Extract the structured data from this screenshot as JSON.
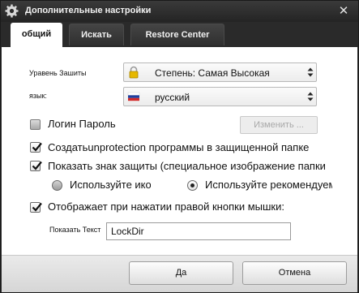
{
  "window": {
    "title": "Дополнительные настройки",
    "close_glyph": "✕"
  },
  "tabs": [
    {
      "label": "общий",
      "active": true
    },
    {
      "label": "Искать",
      "active": false
    },
    {
      "label": "Restore Center",
      "active": false
    }
  ],
  "protection": {
    "label": "Уравень Зашиты",
    "value": "Степень: Самая Высокая",
    "icon": "padlock-icon"
  },
  "language": {
    "label": "язык:",
    "value": "русский",
    "icon": "russian-flag-icon"
  },
  "login_password": {
    "label": "Логин Пароль",
    "checked": false,
    "change_button": "Изменить ..."
  },
  "options": {
    "create_unprotection": {
      "label": "Создатьunprotection программы в защищенной папке",
      "checked": true
    },
    "show_sign": {
      "label": "Показать знак защиты (специальное изображение папки)",
      "checked": true
    },
    "radio_icon": {
      "label": "Используйте иконку",
      "selected": false
    },
    "radio_recommended": {
      "label": "Используйте рекомендуемое",
      "selected": true
    },
    "context_menu": {
      "label": "Отображает при нажатии правой кнопки мышки:",
      "checked": true
    }
  },
  "show_text": {
    "label": "Показать Текст",
    "value": "LockDir"
  },
  "buttons": {
    "ok": "Да",
    "cancel": "Отмена"
  },
  "colors": {
    "titlebar": "#2a2a2a",
    "dialog_bg": "#ffffff",
    "footer_bg": "#e0e0e0",
    "accent_padlock": "#e6b800"
  }
}
